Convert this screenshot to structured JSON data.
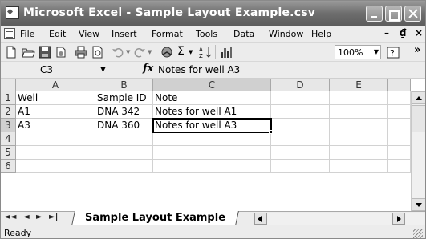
{
  "window": {
    "title": "Microsoft Excel - Sample Layout Example.csv"
  },
  "menu": {
    "items": [
      "File",
      "Edit",
      "View",
      "Insert",
      "Format",
      "Tools",
      "Data",
      "Window",
      "Help"
    ],
    "doc_controls": [
      "–",
      "₫",
      "×"
    ]
  },
  "toolbar": {
    "zoom": "100%",
    "sum_symbol": "Σ",
    "more": "»"
  },
  "formula_bar": {
    "name_box": "C3",
    "fx_label": "fx",
    "content": "Notes for well A3"
  },
  "grid": {
    "columns": [
      "A",
      "B",
      "C",
      "D",
      "E"
    ],
    "rows": [
      "1",
      "2",
      "3",
      "4",
      "5",
      "6"
    ],
    "cells": [
      [
        "Well",
        "Sample ID",
        "Note",
        "",
        ""
      ],
      [
        "A1",
        "DNA 342",
        "Notes for well A1",
        "",
        ""
      ],
      [
        "A3",
        "DNA 360",
        "Notes for well A3",
        "",
        ""
      ],
      [
        "",
        "",
        "",
        "",
        ""
      ],
      [
        "",
        "",
        "",
        "",
        ""
      ],
      [
        "",
        "",
        "",
        "",
        ""
      ]
    ],
    "active_cell": "C3"
  },
  "sheet_tabs": {
    "nav": [
      "◄◄",
      "◄",
      "►",
      "►|"
    ],
    "tabs": [
      "Sample Layout Example"
    ]
  },
  "status": {
    "text": "Ready"
  }
}
